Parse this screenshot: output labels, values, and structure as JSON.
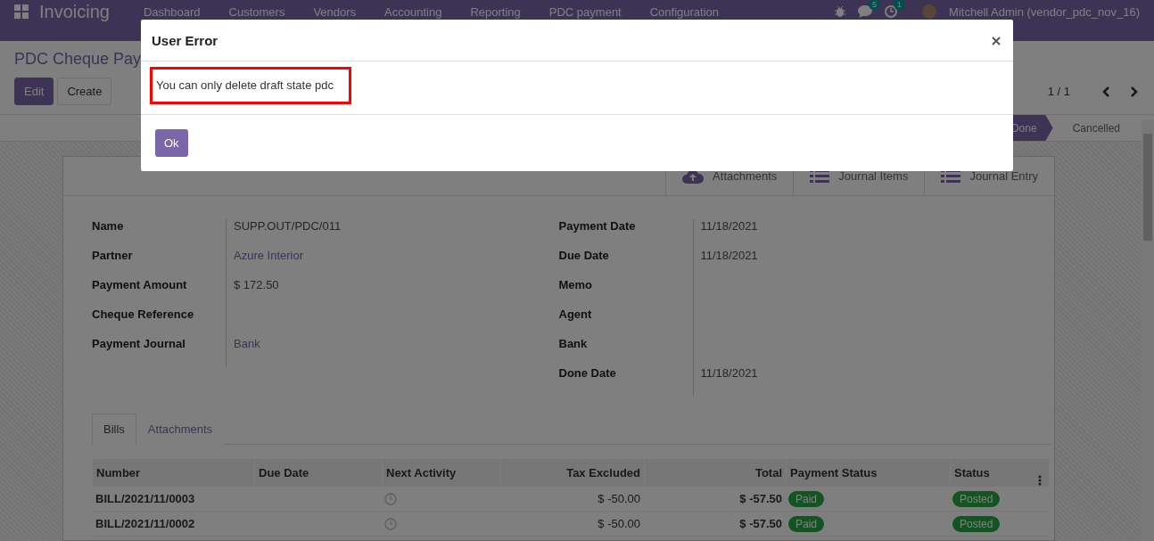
{
  "app": {
    "name": "Invoicing",
    "menu": [
      "Dashboard",
      "Customers",
      "Vendors",
      "Accounting",
      "Reporting",
      "PDC payment",
      "Configuration"
    ],
    "notifications": [
      {
        "kind": "chat",
        "count": "5"
      },
      {
        "kind": "activity",
        "count": "1"
      }
    ],
    "user": "Mitchell Admin (vendor_pdc_nov_16)"
  },
  "breadcrumb": "PDC Cheque Pay",
  "buttons": [
    {
      "label": "Edit",
      "kind": "primary"
    },
    {
      "label": "Create",
      "kind": "secondary"
    }
  ],
  "pager": "1 / 1",
  "stages": [
    {
      "label": "Done",
      "selected": true
    },
    {
      "label": "Cancelled",
      "selected": false
    }
  ],
  "smart_buttons": [
    {
      "label": "Attachments",
      "kind": "upload"
    },
    {
      "label": "Journal Items",
      "kind": "list"
    },
    {
      "label": "Journal Entry",
      "kind": "list"
    }
  ],
  "fields_left": [
    {
      "label": "Name",
      "value": "SUPP.OUT/PDC/011",
      "kind": "text"
    },
    {
      "label": "Partner",
      "value": "Azure Interior",
      "kind": "link"
    },
    {
      "label": "Payment Amount",
      "value": "$ 172.50",
      "kind": "text"
    },
    {
      "label": "Cheque Reference",
      "kind": "empty"
    },
    {
      "label": "Payment Journal",
      "value": "Bank",
      "kind": "link"
    }
  ],
  "fields_right": [
    {
      "label": "Payment Date",
      "value": "11/18/2021",
      "kind": "text"
    },
    {
      "label": "Due Date",
      "value": "11/18/2021",
      "kind": "text"
    },
    {
      "label": "Memo",
      "kind": "empty"
    },
    {
      "label": "Agent",
      "kind": "empty"
    },
    {
      "label": "Bank",
      "kind": "empty"
    },
    {
      "label": "Done Date",
      "value": "11/18/2021",
      "kind": "text"
    }
  ],
  "tabs": [
    {
      "label": "Bills",
      "selected": true
    },
    {
      "label": "Attachments",
      "selected": false
    }
  ],
  "table": {
    "columns": [
      "Number",
      "Due Date",
      "Next Activity",
      "Tax Excluded",
      "Total",
      "Payment Status",
      "Status"
    ],
    "rows": [
      {
        "number": "BILL/2021/11/0003",
        "tax_excluded": "$ -50.00",
        "total": "$ -57.50",
        "payment_status": "Paid",
        "status": "Posted"
      },
      {
        "number": "BILL/2021/11/0002",
        "tax_excluded": "$ -50.00",
        "total": "$ -57.50",
        "payment_status": "Paid",
        "status": "Posted"
      }
    ]
  },
  "dialog": {
    "title": "User Error",
    "message": "You can only delete draft state pdc",
    "highlighted": true,
    "button": "Ok"
  }
}
